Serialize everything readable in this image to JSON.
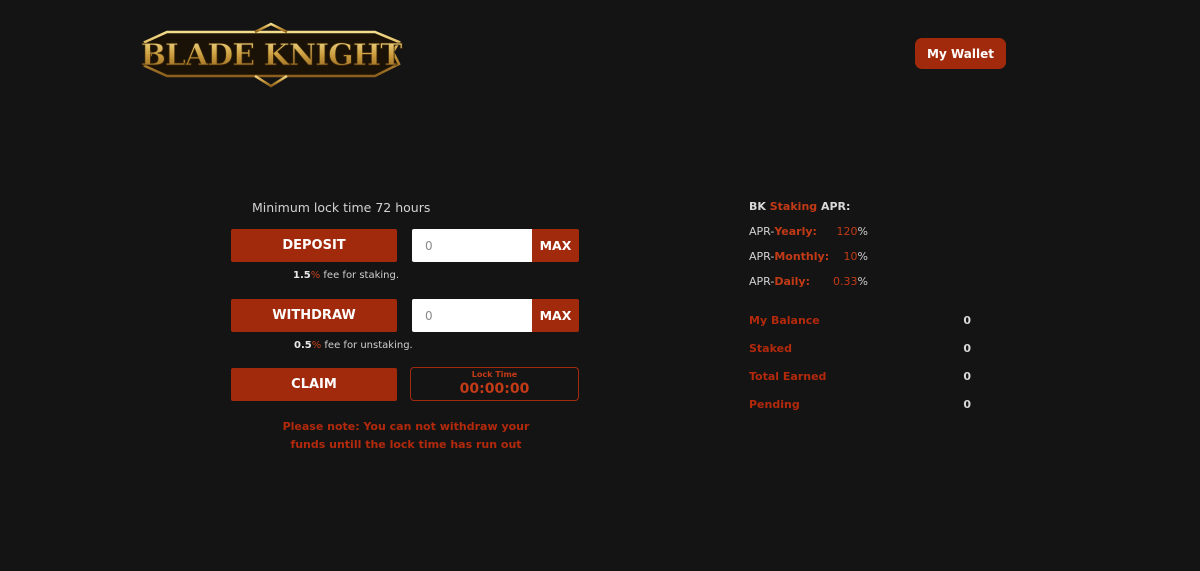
{
  "header": {
    "logo_text": "BLADE KNIGHT",
    "wallet_button": "My Wallet"
  },
  "staking": {
    "lock_note": "Minimum lock time 72 hours",
    "deposit": {
      "button": "DEPOSIT",
      "placeholder": "0",
      "max": "MAX",
      "fee_value": "1.5",
      "fee_pct": "%",
      "fee_text": " fee for staking."
    },
    "withdraw": {
      "button": "WITHDRAW",
      "placeholder": "0",
      "max": "MAX",
      "fee_value": "0.5",
      "fee_pct": "%",
      "fee_text": " fee for unstaking."
    },
    "claim": {
      "button": "CLAIM",
      "lock_label": "Lock Time",
      "lock_value": "00:00:00"
    },
    "warning_line1": "Please note: You can not withdraw your",
    "warning_line2": "funds untill the lock time has run out"
  },
  "apr": {
    "title_prefix": "BK ",
    "title_accent": "Staking",
    "title_suffix": " APR:",
    "rows": [
      {
        "prefix": "APR-",
        "period": "Yearly:",
        "value": "120",
        "pct": "%"
      },
      {
        "prefix": "APR-",
        "period": "Monthly:",
        "value": "10",
        "pct": "%"
      },
      {
        "prefix": "APR-",
        "period": "Daily:",
        "value": "0.33",
        "pct": "%"
      }
    ]
  },
  "stats": [
    {
      "label": "My Balance",
      "value": "0"
    },
    {
      "label": "Staked",
      "value": "0"
    },
    {
      "label": "Total Earned",
      "value": "0"
    },
    {
      "label": "Pending",
      "value": "0"
    }
  ],
  "colors": {
    "background": "#141414",
    "accent": "#a22a0c",
    "accent_text": "#c23a16",
    "logo_gold": "#c9a24a"
  }
}
